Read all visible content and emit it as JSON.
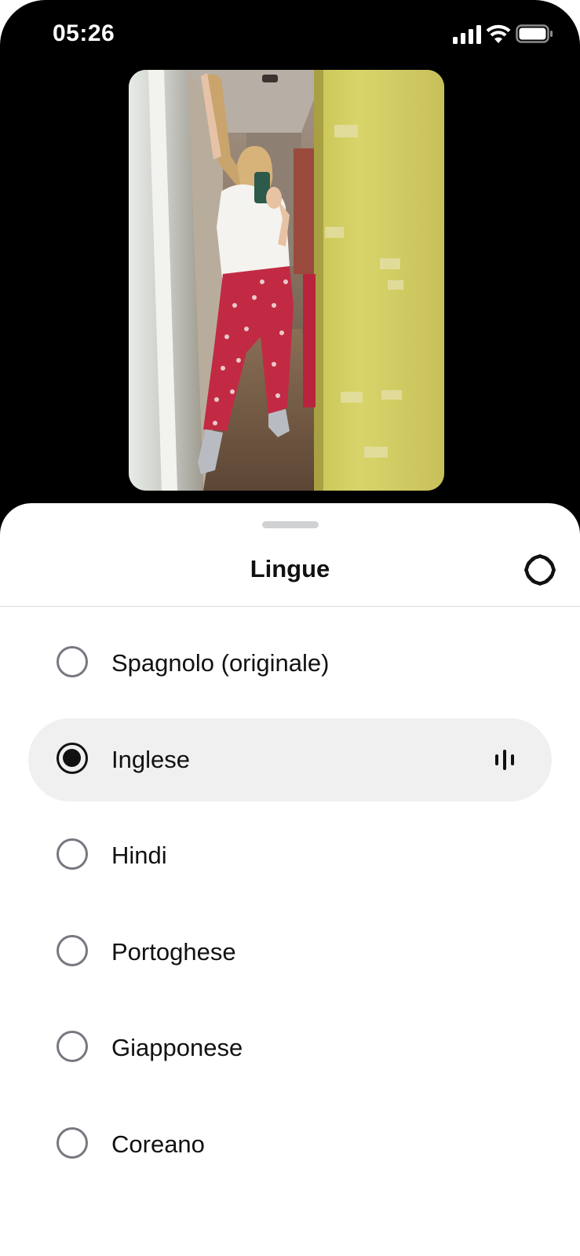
{
  "status_bar": {
    "time": "05:26",
    "icons": [
      "cellular-signal-icon",
      "wifi-icon",
      "battery-icon"
    ]
  },
  "photo": {
    "description_icon": "video-frame"
  },
  "sheet": {
    "title": "Lingue",
    "settings_icon": "gear-icon",
    "languages": [
      {
        "label": "Spagnolo (originale)",
        "selected": false
      },
      {
        "label": "Inglese",
        "selected": true,
        "playing_icon": "audio-waveform-icon"
      },
      {
        "label": "Hindi",
        "selected": false
      },
      {
        "label": "Portoghese",
        "selected": false
      },
      {
        "label": "Giapponese",
        "selected": false
      },
      {
        "label": "Coreano",
        "selected": false
      }
    ]
  },
  "colors": {
    "background": "#000000",
    "sheet": "#ffffff",
    "selected_row": "#f0f0f1",
    "text": "#111111",
    "radio_border": "#767880"
  }
}
